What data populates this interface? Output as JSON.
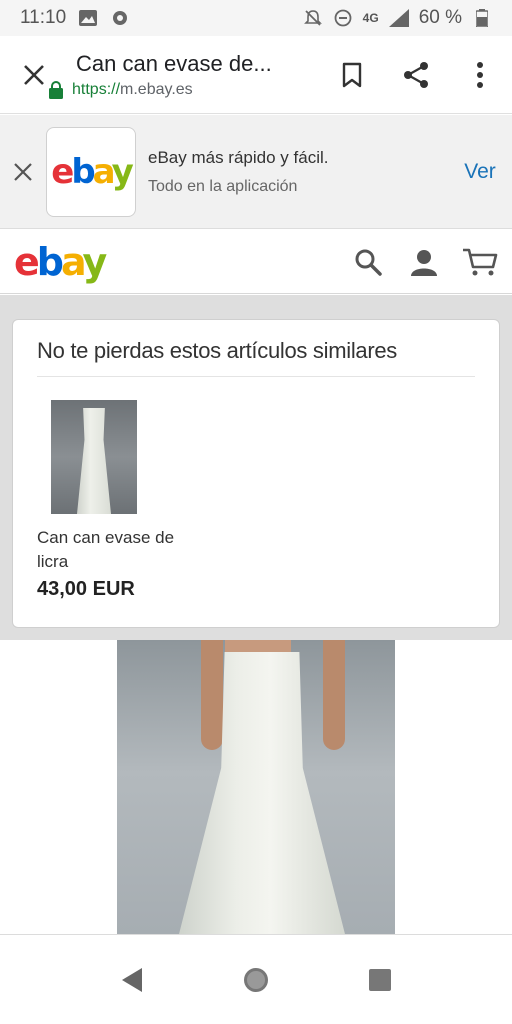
{
  "status_bar": {
    "time": "11:10",
    "network": "4G",
    "battery_percent": "60 %"
  },
  "browser": {
    "page_title": "Can can evase de...",
    "url_scheme": "https://",
    "url_host": "m.ebay.es"
  },
  "app_banner": {
    "title": "eBay más rápido y fácil.",
    "subtitle": "Todo en la aplicación",
    "cta": "Ver"
  },
  "logo": {
    "e": "e",
    "b": "b",
    "a": "a",
    "y": "y"
  },
  "similar": {
    "heading": "No te pierdas estos artículos similares",
    "items": [
      {
        "name": "Can can evase de licra",
        "price": "43,00 EUR"
      }
    ]
  },
  "colors": {
    "ebay_red": "#e53238",
    "ebay_blue": "#0064d2",
    "ebay_yellow": "#f5af02",
    "ebay_green": "#86b817",
    "link_blue": "#1a73b8",
    "secure_green": "#188038"
  },
  "icons": {
    "toolbar": [
      "close-icon",
      "lock-icon",
      "bookmark-icon",
      "share-icon",
      "more-vert-icon"
    ],
    "header": [
      "search-icon",
      "account-icon",
      "cart-icon"
    ],
    "nav": [
      "back-icon",
      "home-icon",
      "recents-icon"
    ]
  }
}
